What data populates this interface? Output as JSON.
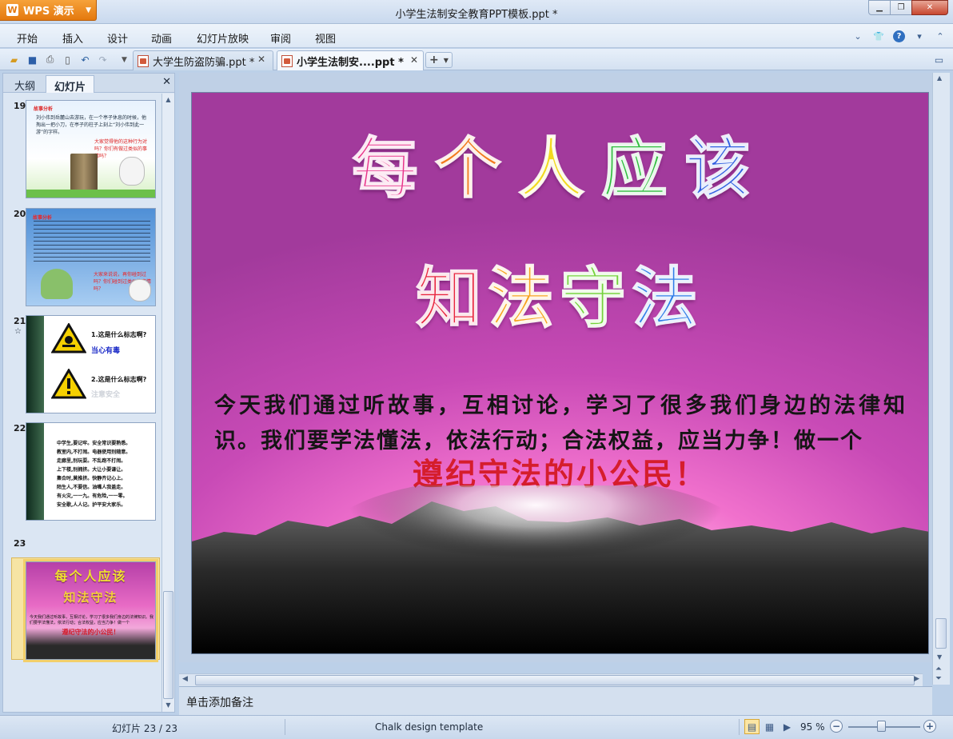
{
  "window": {
    "app_button": "WPS 演示",
    "title": "小学生法制安全教育PPT模板.ppt *"
  },
  "menu": [
    "开始",
    "插入",
    "设计",
    "动画",
    "幻灯片放映",
    "审阅",
    "视图"
  ],
  "tabs": [
    {
      "label": "大学生防盗防骗.ppt *",
      "active": false
    },
    {
      "label": "小学生法制安....ppt *",
      "active": true
    }
  ],
  "panel": {
    "tab_outline": "大纲",
    "tab_slides": "幻灯片"
  },
  "thumbnails": [
    {
      "number": "19",
      "title": "故事分析",
      "body": "刘小伟到岳麓山去游玩，在一个亭子休息的时候，他掏出一把小刀，在亭子的柱子上刻上“刘小伟到此一游”的字样。",
      "question": "大家觉得他的这种行为对吗？你们有做过类似的事情吗？"
    },
    {
      "number": "20",
      "title": "故事分析",
      "question": "大家来说说，再你碰到过吗？你们碰到过类似的事情吗？"
    },
    {
      "number": "21",
      "star": "☆",
      "q1": "1.这是什么标志啊?",
      "a1": "当心有毒",
      "q2": "2.这是什么标志啊?",
      "a2": "注意安全"
    },
    {
      "number": "22",
      "lines": [
        "中学生,要记牢。安全常识要熟悉。",
        "教室内,不打闹。电器使用别随意。",
        "走廊里,别玩耍。不乱跑不打闹。",
        "上下楼,别拥挤。大让小要谦让。",
        "集合时,莫推挤。快静齐记心上。",
        "陌生人,不要信。油嘴人我盖走。",
        "有火灾,一一九。有危险,一一零。",
        "安全歌,人人记。护平安大家乐。"
      ]
    },
    {
      "number": "23",
      "line1": "每个人应该",
      "line2": "知法守法",
      "body": "今天我们通过听故事，互相讨论，学习了很多我们身边的法律知识。我们要学法懂法，依法行动；合法权益，应当力争！做一个",
      "highlight": "遵纪守法的小公民！"
    }
  ],
  "slide": {
    "line1": [
      "每",
      "个",
      "人",
      "应",
      "该"
    ],
    "line2": [
      "知",
      "法",
      "守",
      "法"
    ],
    "body": "今天我们通过听故事，互相讨论，学习了很多我们身边的法律知识。我们要学法懂法，依法行动；合法权益，应当力争！做一个",
    "highlight": "遵纪守法的小公民！",
    "line1_colors": [
      "#e8338a",
      "#f2781c",
      "#f2d91f",
      "#2dbb3c",
      "#2f5ee0"
    ],
    "line2_colors": [
      "#e8243e",
      "#f7a21e",
      "#74d23a",
      "#2f7ce8"
    ]
  },
  "notes_placeholder": "单击添加备注",
  "status": {
    "slide_info": "幻灯片 23 / 23",
    "template": "Chalk design template",
    "zoom": "95 %"
  }
}
